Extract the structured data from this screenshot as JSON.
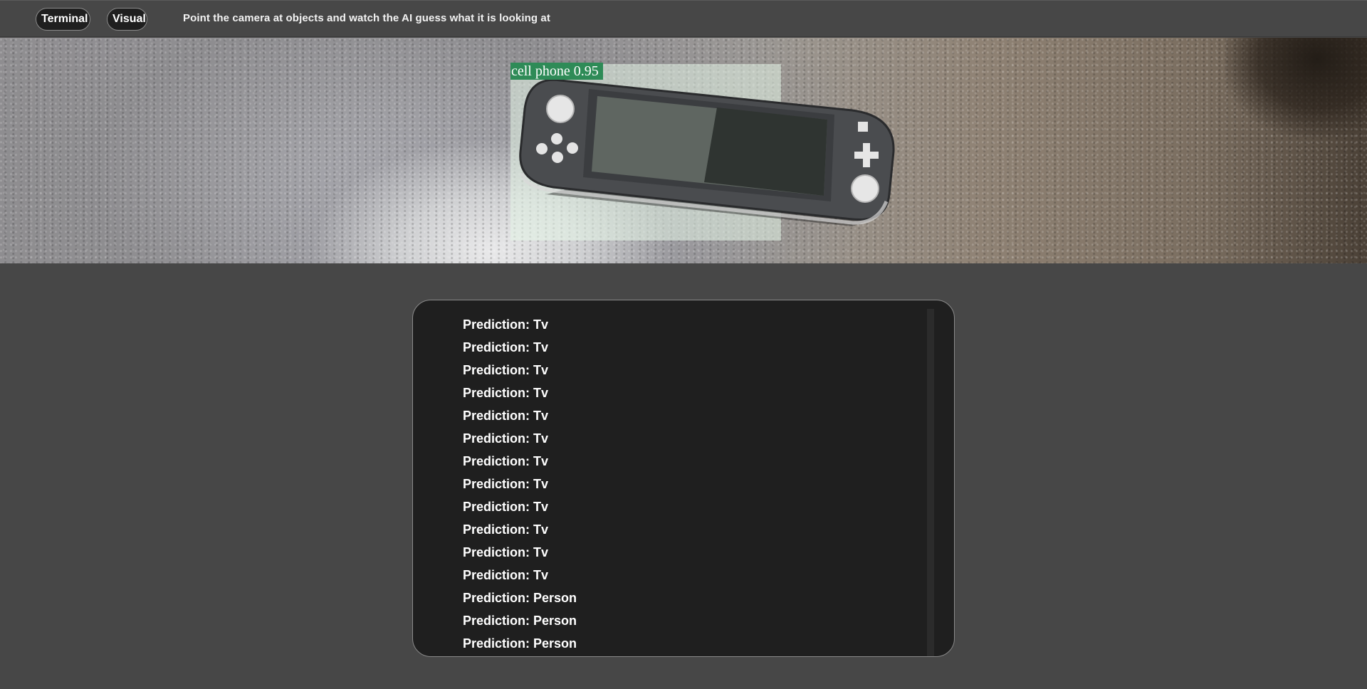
{
  "header": {
    "tabs": [
      {
        "label": "Terminal"
      },
      {
        "label": "Visual"
      }
    ],
    "subtitle": "Point the camera at objects and watch the AI guess what it is looking at"
  },
  "camera": {
    "detection": {
      "label": "cell phone 0.95",
      "class": "cell phone",
      "confidence": 0.95,
      "box_color": "#2e8b57"
    }
  },
  "log": {
    "items": [
      "Prediction: Tv",
      "Prediction: Tv",
      "Prediction: Tv",
      "Prediction: Tv",
      "Prediction: Tv",
      "Prediction: Tv",
      "Prediction: Tv",
      "Prediction: Tv",
      "Prediction: Tv",
      "Prediction: Tv",
      "Prediction: Tv",
      "Prediction: Tv",
      "Prediction: Person",
      "Prediction: Person",
      "Prediction: Person"
    ]
  },
  "colors": {
    "background": "#474747",
    "panel": "#1f1f1f",
    "text": "#ffffff",
    "detection_label_bg": "#2e8b57"
  }
}
